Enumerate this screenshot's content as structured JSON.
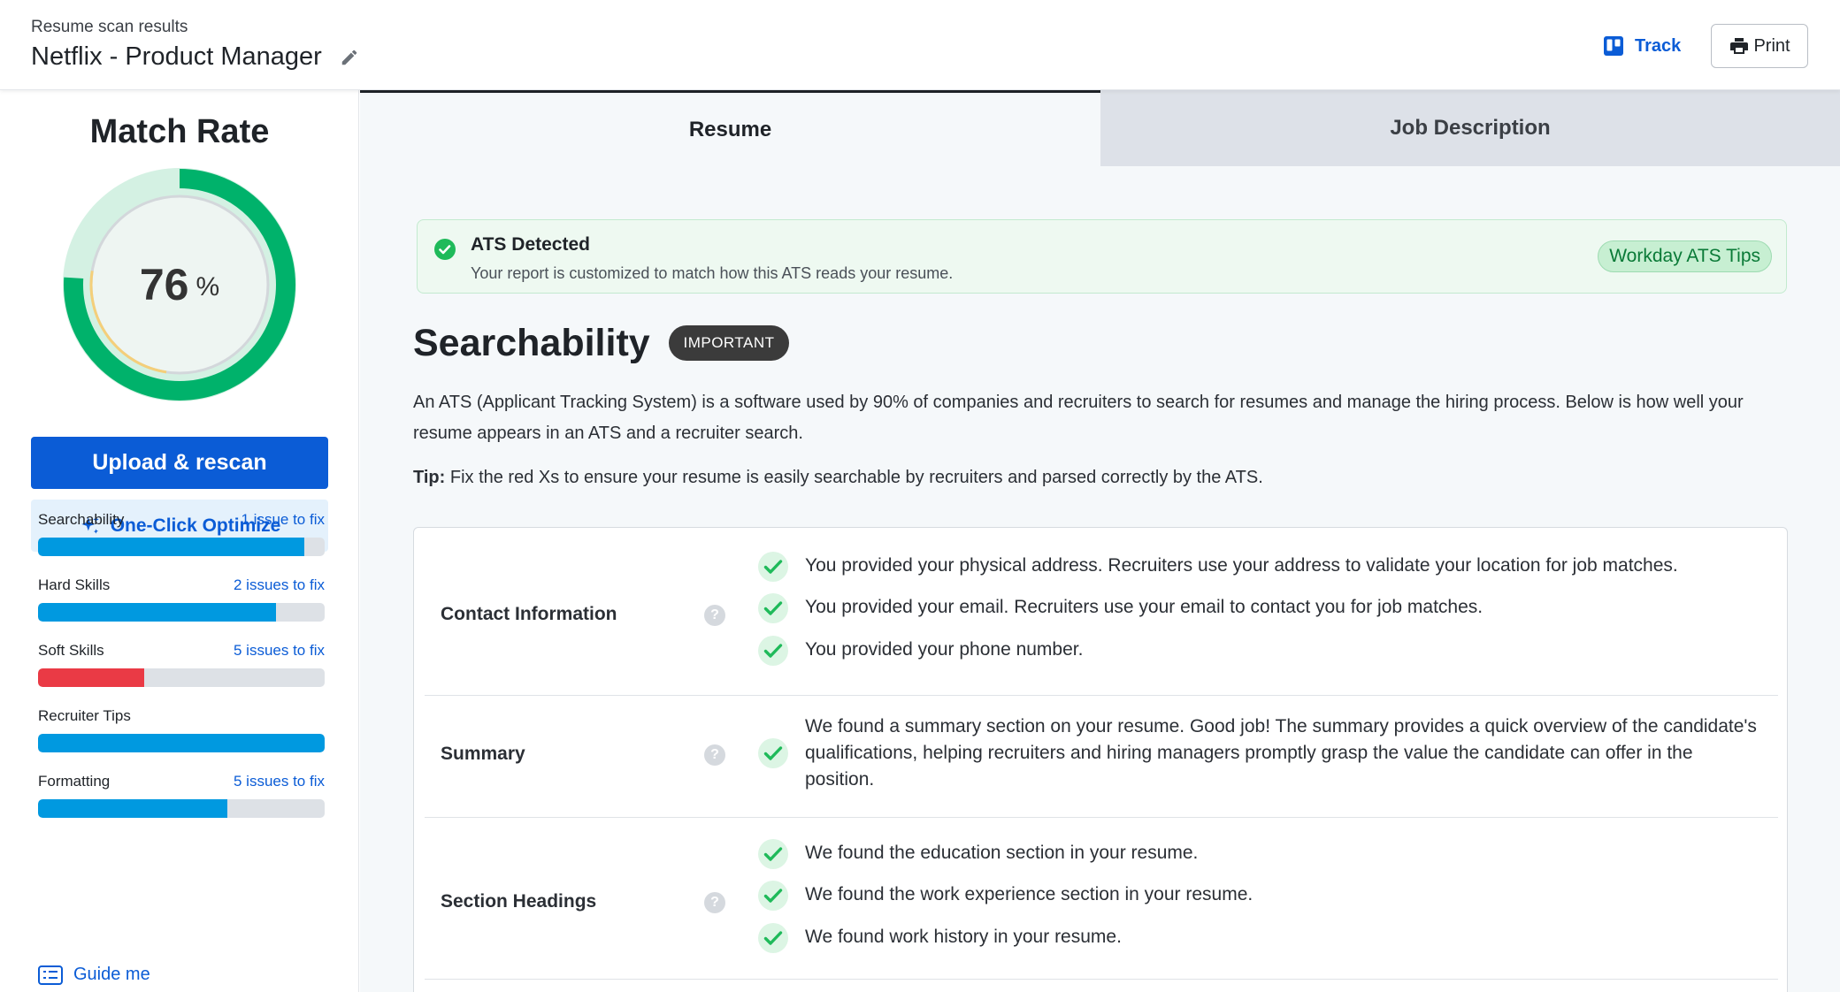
{
  "header": {
    "subtitle": "Resume scan results",
    "title": "Netflix - Product Manager",
    "track_label": "Track",
    "print_label": "Print"
  },
  "sidebar": {
    "match_title": "Match Rate",
    "match_value": "76",
    "match_unit": "%",
    "match_fraction": 0.76,
    "upload_label": "Upload & rescan",
    "optimize_label": "One-Click Optimize",
    "progress": [
      {
        "label": "Searchability",
        "issues": "1 issue to fix",
        "fill": 0.93,
        "color": "#0099e0"
      },
      {
        "label": "Hard Skills",
        "issues": "2 issues to fix",
        "fill": 0.83,
        "color": "#0099e0"
      },
      {
        "label": "Soft Skills",
        "issues": "5 issues to fix",
        "fill": 0.37,
        "color": "#ea3a45"
      },
      {
        "label": "Recruiter Tips",
        "issues": "",
        "fill": 1.0,
        "color": "#0099e0"
      },
      {
        "label": "Formatting",
        "issues": "5 issues to fix",
        "fill": 0.66,
        "color": "#0099e0"
      }
    ],
    "guide_label": "Guide me"
  },
  "tabs": {
    "resume": "Resume",
    "job_description": "Job Description"
  },
  "ats": {
    "title": "ATS Detected",
    "description": "Your report is customized to match how this ATS reads your resume.",
    "tips_label": "Workday ATS Tips"
  },
  "searchability": {
    "title": "Searchability",
    "badge": "IMPORTANT",
    "description": "An ATS (Applicant Tracking System) is a software used by 90% of companies and recruiters to search for resumes and manage the hiring process. Below is how well your resume appears in an ATS and a recruiter search.",
    "tip_prefix": "Tip:",
    "tip_text": " Fix the red Xs to ensure your resume is easily searchable by recruiters and parsed correctly by the ATS."
  },
  "sections": [
    {
      "name": "Contact Information",
      "checks": [
        "You provided your physical address. Recruiters use your address to validate your location for job matches.",
        "You provided your email. Recruiters use your email to contact you for job matches.",
        "You provided your phone number."
      ]
    },
    {
      "name": "Summary",
      "checks": [
        "We found a summary section on your resume. Good job! The summary provides a quick overview of the candidate's qualifications, helping recruiters and hiring managers promptly grasp the value the candidate can offer in the position."
      ]
    },
    {
      "name": "Section Headings",
      "checks": [
        "We found the education section in your resume.",
        "We found the work experience section in your resume.",
        "We found work history in your resume."
      ]
    }
  ],
  "icons": {
    "help": "?"
  },
  "colors": {
    "accent": "#0b5cd6",
    "gauge_green": "#00b26b",
    "check_green": "#1fba5a"
  }
}
